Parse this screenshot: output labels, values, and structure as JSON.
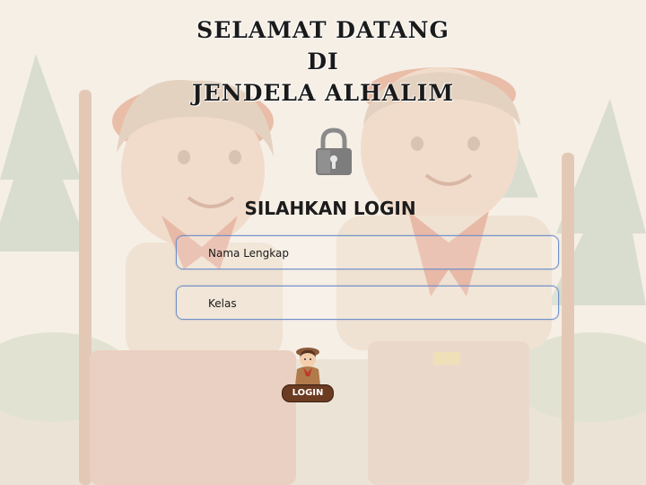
{
  "header": {
    "line1": "SELAMAT DATANG",
    "line2": "DI",
    "line3": "JENDELA ALHALIM"
  },
  "form": {
    "heading": "SILAHKAN LOGIN",
    "name_placeholder": "Nama Lengkap",
    "class_placeholder": "Kelas",
    "login_label": "LOGIN"
  },
  "icons": {
    "lock": "lock-icon",
    "scout": "scout-girl-icon"
  },
  "colors": {
    "background": "#f6efe6",
    "field_border": "#6f8fc9",
    "button": "#6b3b22"
  }
}
